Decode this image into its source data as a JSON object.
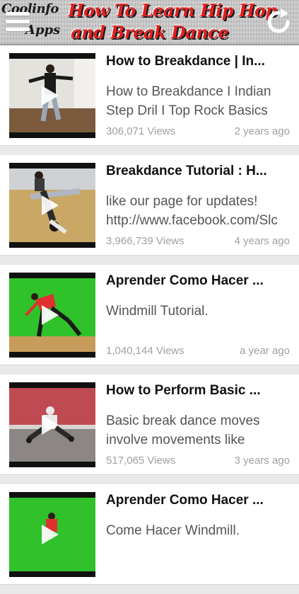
{
  "header": {
    "brand_line1": "Coolinfo",
    "brand_line2": "Apps",
    "title_line1": "How To Learn Hip Hop",
    "title_line2": "and Break Dance"
  },
  "icons": {
    "menu": "menu-icon",
    "refresh": "refresh-icon",
    "play": "play-icon"
  },
  "videos": [
    {
      "title": "How to Breakdance | In...",
      "description": "How to Breakdance I Indian\nStep Dril I Top Rock Basics",
      "views": "306,071 Views",
      "age": "2 years ago"
    },
    {
      "title": "Breakdance Tutorial : H...",
      "description": "like our page for updates!\nhttp://www.facebook.com/Slc",
      "views": "3,966,739 Views",
      "age": "4 years ago"
    },
    {
      "title": "Aprender Como Hacer ...",
      "description": "Windmill Tutorial.",
      "views": "1,040,144 Views",
      "age": "a year ago"
    },
    {
      "title": "How to Perform Basic ...",
      "description": "Basic break dance moves\ninvolve movements like",
      "views": "517,065 Views",
      "age": "3 years ago"
    },
    {
      "title": "Aprender Como Hacer ...",
      "description": "Come Hacer Windmill.",
      "views": "",
      "age": ""
    }
  ],
  "colors": {
    "header_bg": "#c9c9c9",
    "title_red": "#e02020",
    "list_bg": "#e9e9e9",
    "meta_gray": "#a0a0a0"
  }
}
